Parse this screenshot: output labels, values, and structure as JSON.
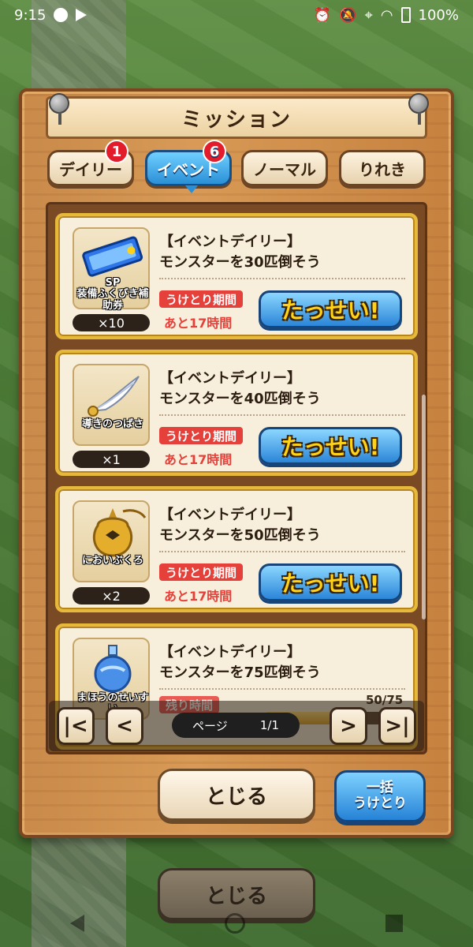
{
  "status_bar": {
    "time": "9:15",
    "battery": "100%"
  },
  "dialog": {
    "title": "ミッション"
  },
  "tabs": [
    {
      "label": "デイリー",
      "badge": "1",
      "active": false
    },
    {
      "label": "イベント",
      "badge": "6",
      "active": true
    },
    {
      "label": "ノーマル",
      "badge": "",
      "active": false
    },
    {
      "label": "りれき",
      "badge": "",
      "active": false
    }
  ],
  "missions": [
    {
      "category": "【イベントデイリー】",
      "description": "モンスターを30匹倒そう",
      "reward_name_line1": "SP",
      "reward_name_line2": "装備ふくびき補助券",
      "reward_qty": "×10",
      "period_label": "うけとり期間",
      "period_left": "あと17時間",
      "button_label": "たっせい!",
      "icon": "ticket-icon"
    },
    {
      "category": "【イベントデイリー】",
      "description": "モンスターを40匹倒そう",
      "reward_name_line1": "導きのつばさ",
      "reward_qty": "×1",
      "period_label": "うけとり期間",
      "period_left": "あと17時間",
      "button_label": "たっせい!",
      "icon": "wing-icon"
    },
    {
      "category": "【イベントデイリー】",
      "description": "モンスターを50匹倒そう",
      "reward_name_line1": "においぶくろ",
      "reward_qty": "×2",
      "period_label": "うけとり期間",
      "period_left": "あと17時間",
      "button_label": "たっせい!",
      "icon": "pouch-icon"
    },
    {
      "category": "【イベントデイリー】",
      "description": "モンスターを75匹倒そう",
      "reward_name_line1": "まほうのせいすい",
      "remaining_label": "残り時間",
      "progress_text": "50/75",
      "progress_fraction": 0.667,
      "icon": "potion-icon"
    }
  ],
  "pager": {
    "label": "ページ",
    "value": "1/1",
    "first_glyph": "|<",
    "prev_glyph": "<",
    "next_glyph": ">",
    "last_glyph": ">|"
  },
  "footer": {
    "close_label": "とじる",
    "bulk_line1": "一括",
    "bulk_line2": "うけとり",
    "behind_close_label": "とじる"
  },
  "colors": {
    "accent_blue": "#2b8fd6",
    "badge_red": "#e21c2a",
    "achieve_gold": "#ffd21a",
    "wood": "#d89a56"
  }
}
